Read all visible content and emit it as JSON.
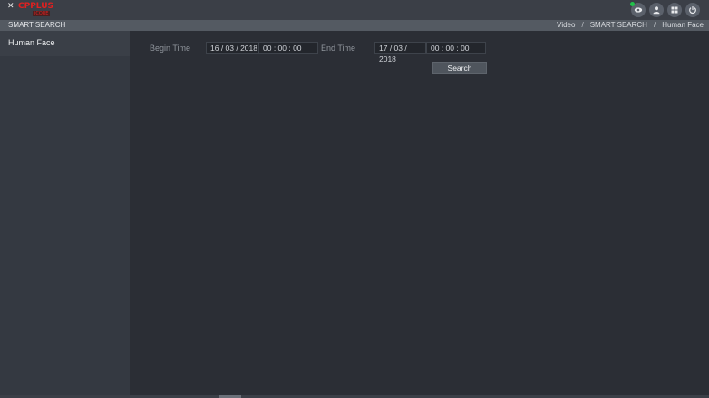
{
  "brand": {
    "name": "CPPLUS",
    "subtitle": "iCORE"
  },
  "header": {
    "title": "SMART SEARCH",
    "breadcrumb": [
      "Video",
      "SMART SEARCH",
      "Human Face"
    ],
    "separator": "/"
  },
  "top_icons": [
    {
      "icon": "eye-icon",
      "status": "online"
    },
    {
      "icon": "user-icon"
    },
    {
      "icon": "grid-icon"
    },
    {
      "icon": "power-icon"
    }
  ],
  "sidebar": {
    "items": [
      {
        "label": "Human Face",
        "selected": true
      }
    ]
  },
  "search_form": {
    "begin_time_label": "Begin Time",
    "begin_date": "16 / 03 / 2018",
    "begin_time": "00 : 00 : 00",
    "end_time_label": "End Time",
    "end_date": "17 / 03 / 2018",
    "end_time": "00 : 00 : 00",
    "search_label": "Search"
  },
  "colors": {
    "brand_red": "#e02020",
    "online_green": "#21c24a",
    "background": "#2b2e35"
  }
}
